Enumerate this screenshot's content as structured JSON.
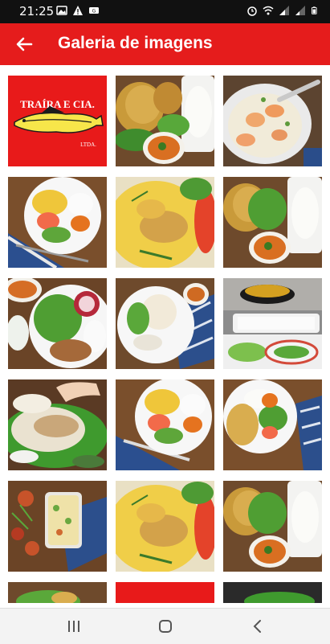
{
  "status_bar": {
    "time": "21:25",
    "left_icons": [
      "image-icon",
      "warning-icon",
      "sim-icon"
    ],
    "right_icons": [
      "alarm-icon",
      "wifi-icon",
      "signal-icon",
      "signal-icon-2",
      "battery-icon"
    ]
  },
  "app_bar": {
    "title": "Galeria de imagens",
    "back_icon": "arrow-back-icon",
    "color": "#e51c1c"
  },
  "gallery": {
    "logo": {
      "line1": "TRAÍRA E CIA.",
      "line2": "LTDA."
    },
    "images": [
      "logo",
      "rice-and-fried-fish-plate",
      "shrimp-dish",
      "plate-fish-sauce-rice-salad",
      "fish-in-sauce-close-up",
      "rice-fried-fish-salad",
      "fish-salad-sauce-plate",
      "grilled-fish-potatoes",
      "rice-tray-and-soup",
      "whole-fish-on-lettuce",
      "plate-fish-sauce-rice-salad",
      "fried-fish-rice-salad-plate",
      "baked-dish-top-view",
      "fish-in-sauce-close-up",
      "rice-fried-fish-salad",
      "partial-salad-plate",
      "red-tile",
      "partial-salad-dark"
    ]
  },
  "nav_bar": {
    "recent_icon": "recent-apps-icon",
    "home_icon": "home-icon",
    "back_icon": "back-nav-icon"
  }
}
